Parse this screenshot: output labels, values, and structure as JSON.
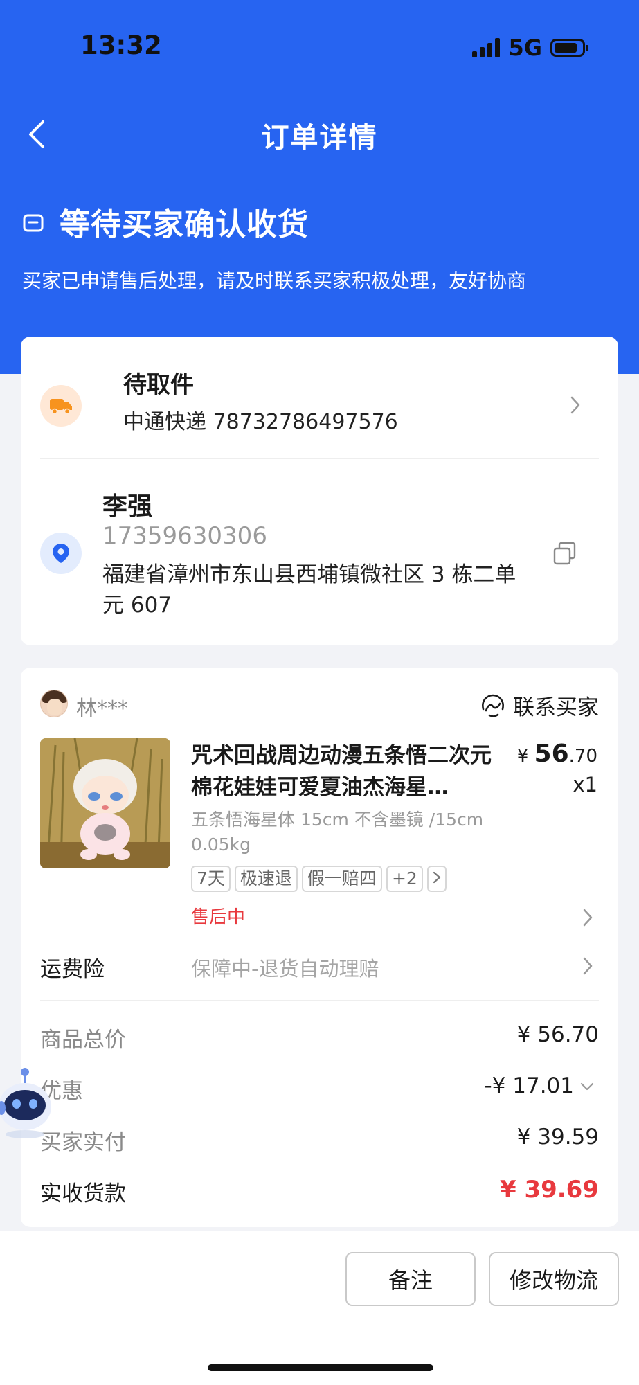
{
  "status_bar": {
    "time": "13:32",
    "network": "5G"
  },
  "nav": {
    "title": "订单详情"
  },
  "order_status": {
    "title": "等待买家确认收货",
    "subtitle": "买家已申请售后处理，请及时联系买家积极处理，友好协商"
  },
  "shipping": {
    "title": "待取件",
    "info": "中通快递 78732786497576"
  },
  "address": {
    "name": "李强",
    "phone": "17359630306",
    "address": "福建省漳州市东山县西埔镇微社区 3 栋二单元 607"
  },
  "buyer": {
    "name": "林***",
    "contact_label": "联系买家"
  },
  "product": {
    "title": "咒术回战周边动漫五条悟二次元棉花娃娃可爱夏油杰海星…",
    "currency": "¥",
    "price_int": "56",
    "price_dec": ".70",
    "quantity": "x1",
    "spec_line1": "五条悟海星体 15cm 不含墨镜 /15cm",
    "spec_line2": "0.05kg",
    "tags": [
      "7天",
      "极速退",
      "假一赔四",
      "+2"
    ],
    "after_sale": "售后中"
  },
  "insurance": {
    "label": "运费险",
    "value": "保障中-退货自动理赔"
  },
  "summary": {
    "goods_total_label": "商品总价",
    "goods_total": "¥ 56.70",
    "discount_label": "优惠",
    "discount": "-¥ 17.01",
    "buyer_paid_label": "买家实付",
    "buyer_paid": "¥ 39.59",
    "received_label": "实收货款",
    "received": "¥ 39.69"
  },
  "actions": {
    "note_label": "备注",
    "modify_logistics_label": "修改物流"
  },
  "colors": {
    "primary": "#2764f1",
    "price_red": "#e8393e",
    "page_bg": "#f2f3f7"
  }
}
